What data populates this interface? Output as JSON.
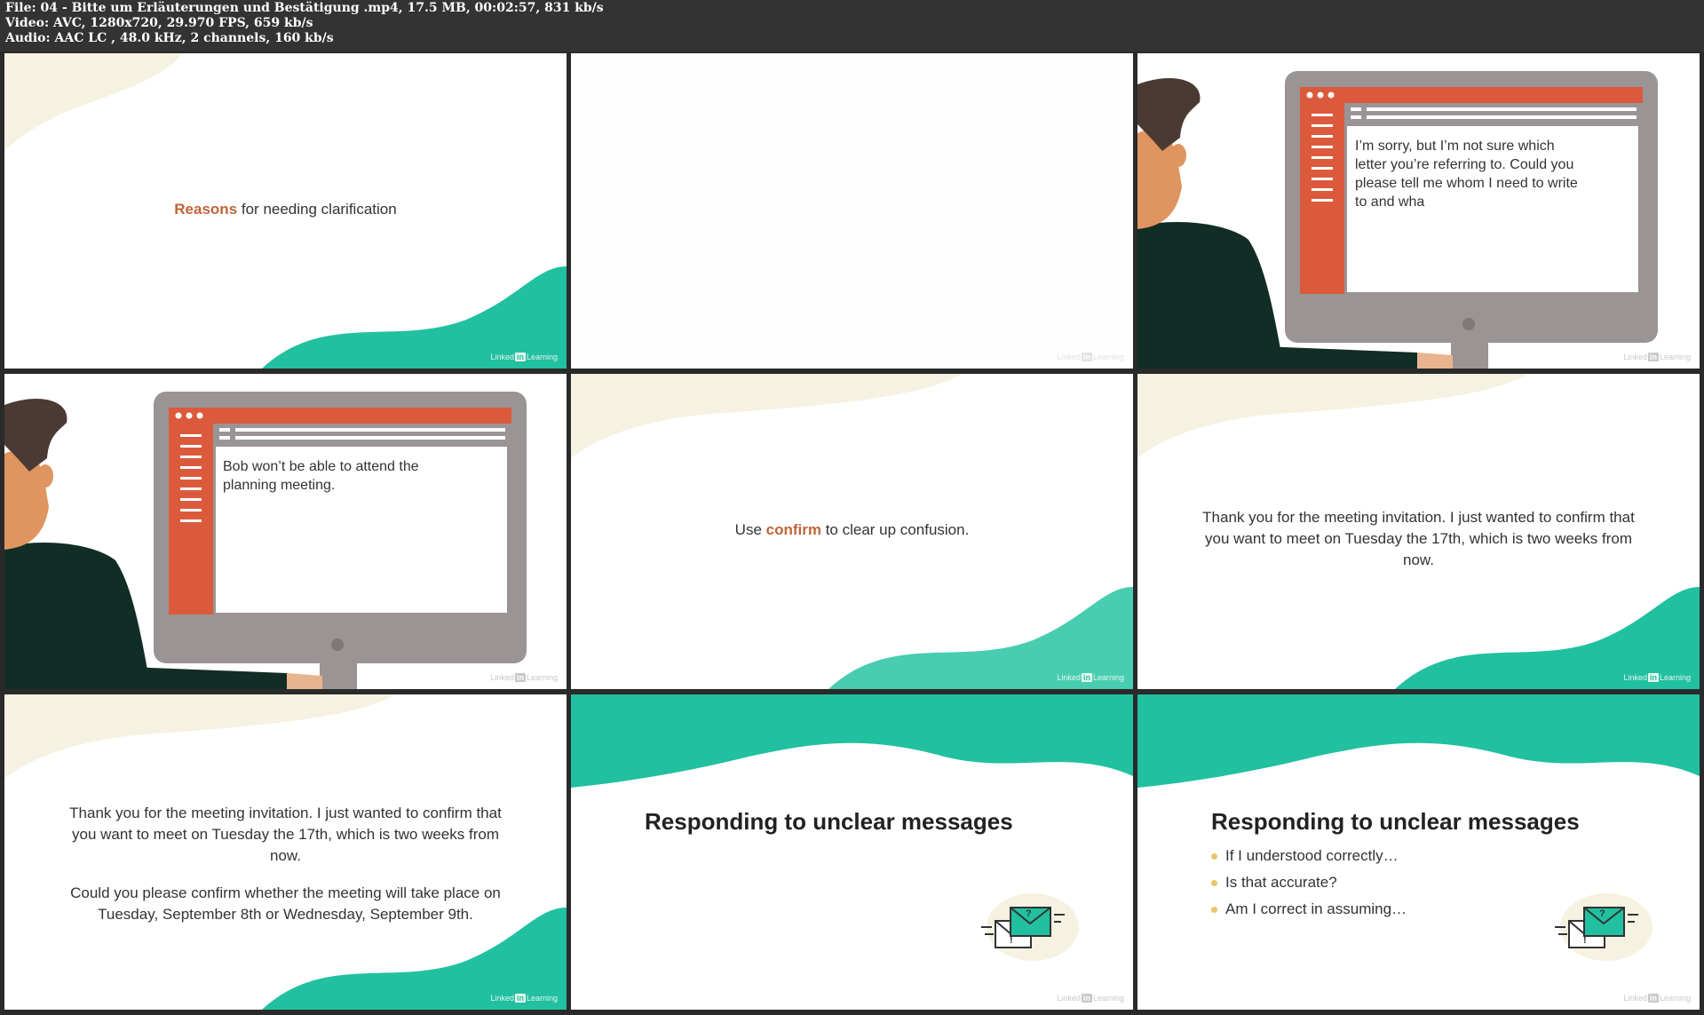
{
  "file_info": {
    "line1": "File: 04 - Bitte um Erläuterungen und Bestätigung .mp4, 17.5 MB, 00:02:57, 831 kb/s",
    "line2": "Video: AVC, 1280x720, 29.970 FPS, 659 kb/s",
    "line3": "Audio: AAC LC , 48.0 kHz, 2 channels, 160 kb/s"
  },
  "logo": {
    "brand": "Linked",
    "in": "in",
    "suffix": "Learning"
  },
  "thumb1": {
    "accent": "Reasons",
    "text": " for needing clarification"
  },
  "thumb3": {
    "screen_text": "I’m sorry, but I’m not sure which letter you’re referring to. Could you please tell me whom I need to write to and wha"
  },
  "thumb4": {
    "screen_text": "Bob won’t be able to attend the planning meeting."
  },
  "thumb5": {
    "pre": "Use ",
    "accent": "confirm",
    "post": " to clear up confusion."
  },
  "thumb6": {
    "text": "Thank you for the meeting invitation. I just wanted to confirm that you want to meet on Tuesday the 17th, which is two weeks from now."
  },
  "thumb7": {
    "para1": "Thank you for the meeting invitation. I just wanted to confirm that you want to meet on Tuesday the 17th, which is two weeks from now.",
    "para2": "Could you please confirm whether the meeting will take place on Tuesday, September 8th or Wednesday, September 9th."
  },
  "thumb8": {
    "title": "Responding to unclear messages"
  },
  "thumb9": {
    "title": "Responding to unclear messages",
    "bullets": [
      "If I understood correctly…",
      "Is that accurate?",
      "Am I correct in assuming…"
    ]
  },
  "colors": {
    "teal": "#21c0a0",
    "cream": "#f6f2e2",
    "accent_text": "#c0643a",
    "monitor_red": "#dc5a3c",
    "monitor_gray": "#9b9494",
    "bullet_yellow": "#e8c56a"
  }
}
